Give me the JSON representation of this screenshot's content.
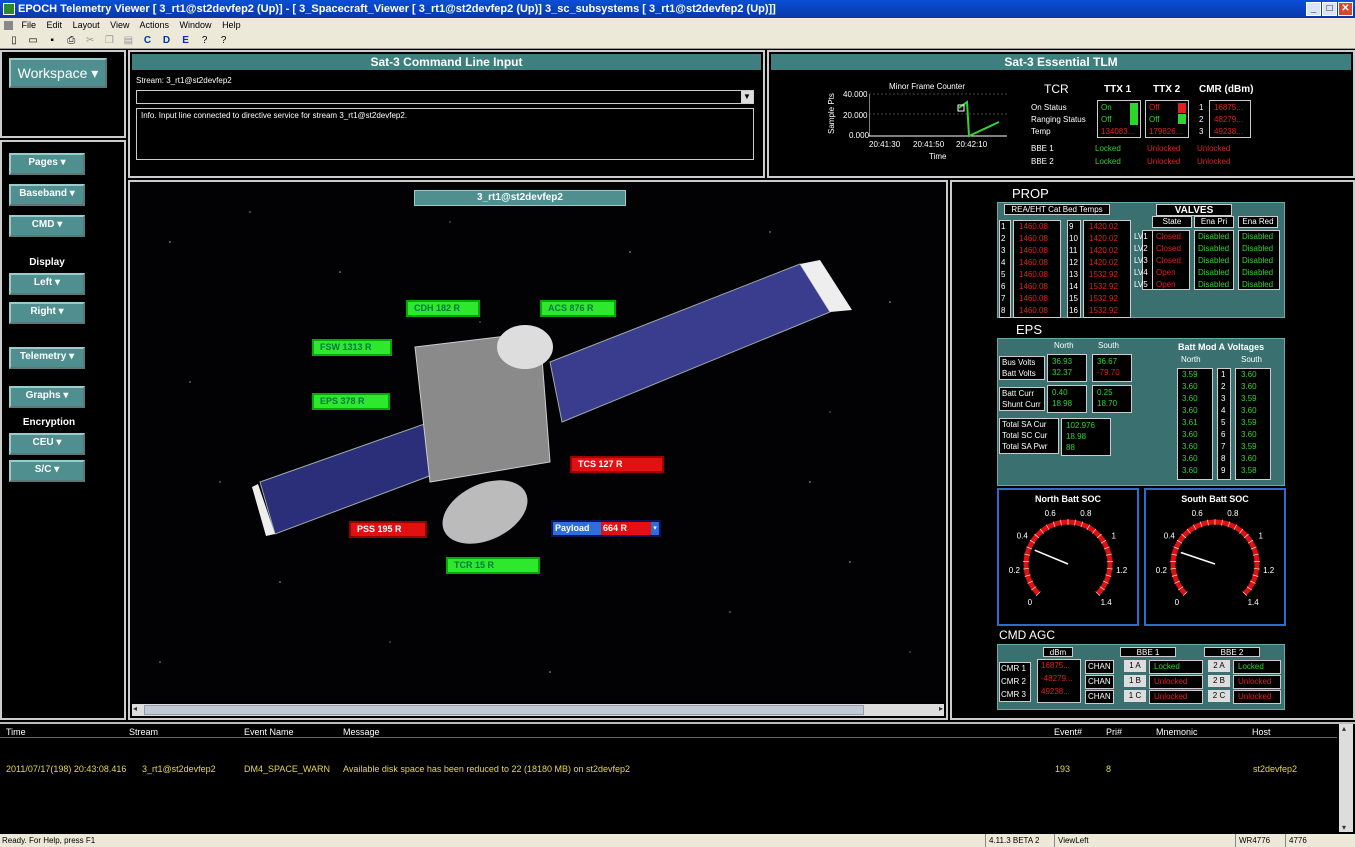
{
  "window": {
    "title": "EPOCH Telemetry Viewer [    3_rt1@st2devfep2 (Up)] - [    3_Spacecraft_Viewer [    3_rt1@st2devfep2 (Up)]    3_sc_subsystems [    3_rt1@st2devfep2 (Up)]]"
  },
  "menu": [
    "File",
    "Edit",
    "Layout",
    "View",
    "Actions",
    "Window",
    "Help"
  ],
  "toolbar": {
    "letters": [
      "C",
      "D",
      "E"
    ]
  },
  "workspace": {
    "label": "Workspace"
  },
  "sidebar": {
    "pages": "Pages",
    "baseband": "Baseband",
    "cmd": "CMD",
    "display_label": "Display",
    "left": "Left",
    "right": "Right",
    "telemetry": "Telemetry",
    "graphs": "Graphs",
    "encryption_label": "Encryption",
    "ceu": "CEU",
    "sc": "S/C"
  },
  "cli": {
    "title": "Sat-3  Command Line Input",
    "stream_label": "Stream: 3_rt1@st2devfep2",
    "info": "Info. Input line connected to directive service for stream 3_rt1@st2devfep2."
  },
  "tlm": {
    "title": "Sat-3  Essential TLM",
    "chart_title": "Minor Frame Counter",
    "ylabel": "Sample Pts",
    "xlabel": "Time",
    "yticks": [
      "40.000",
      "20.000",
      "0.000"
    ],
    "xticks": [
      "20:41:30",
      "20:41:50",
      "20:42:10"
    ],
    "tcr": "TCR",
    "ttx1": "TTX 1",
    "ttx2": "TTX 2",
    "cmr": "CMR (dBm)",
    "rows": [
      "On Status",
      "Ranging Status",
      "Temp"
    ],
    "ttx1_vals": [
      "On",
      "Off",
      "134083..."
    ],
    "ttx2_vals": [
      "Off",
      "Off",
      "179826..."
    ],
    "cmr_nums": [
      "1",
      "2",
      "3"
    ],
    "cmr_vals": [
      "16875...",
      "48279...",
      "49238..."
    ],
    "bbe1": "BBE 1",
    "bbe2": "BBE 2",
    "bbe1_vals": [
      "Locked",
      "Unlocked",
      "Unlocked"
    ],
    "bbe2_vals": [
      "Locked",
      "Unlocked",
      "Unlocked"
    ]
  },
  "viewer": {
    "title": "3_rt1@st2devfep2",
    "labels": {
      "cdh": "CDH  182  R",
      "acs": "ACS  876  R",
      "fsw": "FSW  1313  R",
      "eps": "EPS  378  R",
      "tcs": "TCS  127  R",
      "pss": "PSS  195  R",
      "payload": "Payload",
      "payload_val": "664  R",
      "tcr": "TCR  15  R"
    }
  },
  "prop": {
    "title": "PROP",
    "temps_header": "REA/EHT Cat Bed Temps",
    "left_idx": [
      "1",
      "2",
      "3",
      "4",
      "5",
      "6",
      "7",
      "8"
    ],
    "left_vals": [
      "1460.08",
      "1460.08",
      "1460.08",
      "1460.08",
      "1460.08",
      "1460.08",
      "1460.08",
      "1460.08"
    ],
    "right_idx": [
      "9",
      "10",
      "11",
      "12",
      "13",
      "14",
      "15",
      "16"
    ],
    "right_vals": [
      "1420.02",
      "1420.02",
      "1420.02",
      "1420.02",
      "1532.92",
      "1532.92",
      "1532.92",
      "1532.92"
    ],
    "valves_title": "VALVES",
    "vcols": [
      "State",
      "Ena Pri",
      "Ena Red"
    ],
    "vrows": [
      "LV1",
      "LV2",
      "LV3",
      "LV4",
      "LV5"
    ],
    "state": [
      "Closed",
      "Closed",
      "Closed",
      "Open",
      "Open"
    ],
    "ena_pri": [
      "Disabled",
      "Disabled",
      "Disabled",
      "Disabled",
      "Disabled"
    ],
    "ena_red": [
      "Disabled",
      "Disabled",
      "Disabled",
      "Disabled",
      "Disabled"
    ]
  },
  "eps": {
    "title": "EPS",
    "north": "North",
    "south": "South",
    "bus_volts": "Bus Volts",
    "batt_volts": "Batt Volts",
    "bv_n": [
      "36.93",
      "32.37"
    ],
    "bv_s": [
      "36.67",
      "-79.70"
    ],
    "batt_curr": "Batt Curr",
    "shunt_curr": "Shunt Curr",
    "bc_n": [
      "0.40",
      "18.98"
    ],
    "bc_s": [
      "0.25",
      "18.70"
    ],
    "total_sa_cur": "Total SA Cur",
    "total_sc_cur": "Total SC Cur",
    "total_sa_pwr": "Total SA Pwr",
    "totals": [
      "102.976",
      "18.98",
      "88"
    ],
    "batt_mod": "Batt Mod A Voltages",
    "bm_north": "North",
    "bm_south": "South",
    "bm_idx": [
      "1",
      "2",
      "3",
      "4",
      "5",
      "6",
      "7",
      "8",
      "9"
    ],
    "bm_n": [
      "3.59",
      "3.60",
      "3.60",
      "3.60",
      "3.61",
      "3.60",
      "3.60",
      "3.60",
      "3.60"
    ],
    "bm_s": [
      "3.60",
      "3.60",
      "3.59",
      "3.60",
      "3.59",
      "3.60",
      "3.59",
      "3.60",
      "3.58"
    ],
    "north_soc": "North Batt SOC",
    "south_soc": "South Batt SOC",
    "gauge_ticks": [
      "0",
      "0.2",
      "0.4",
      "0.6",
      "0.8",
      "1",
      "1.2",
      "1.4"
    ],
    "north_soc_value": 0.35,
    "south_soc_value": 0.33
  },
  "cmdagc": {
    "title": "CMD AGC",
    "dbm": "dBm",
    "bbe1": "BBE 1",
    "bbe2": "BBE 2",
    "cmr": [
      "CMR 1",
      "CMR 2",
      "CMR 3"
    ],
    "dbm_vals": [
      "16875...",
      "-48279...",
      "49238..."
    ],
    "chan": [
      "CHAN",
      "CHAN",
      "CHAN"
    ],
    "b1_ids": [
      "1 A",
      "1 B",
      "1 C"
    ],
    "b1_vals": [
      "Locked",
      "Unlocked",
      "Unlocked"
    ],
    "b2_ids": [
      "2 A",
      "2 B",
      "2 C"
    ],
    "b2_vals": [
      "Locked",
      "Unlocked",
      "Unlocked"
    ]
  },
  "events": {
    "cols": [
      "Time",
      "Stream",
      "Event Name",
      "Message",
      "Event#",
      "Pri#",
      "Mnemonic",
      "Host"
    ],
    "row": [
      "2011/07/17(198) 20:43:08.416",
      "3_rt1@st2devfep2",
      "DM4_SPACE_WARN",
      "Available disk space has been reduced to 22 (18180 MB) on st2devfep2",
      "193",
      "8",
      "",
      "st2devfep2"
    ]
  },
  "status": {
    "help": "Ready. For Help, press F1",
    "version": "4.11.3 BETA 2",
    "view": "ViewLeft",
    "wr": "WR4776",
    "num": "4776"
  }
}
